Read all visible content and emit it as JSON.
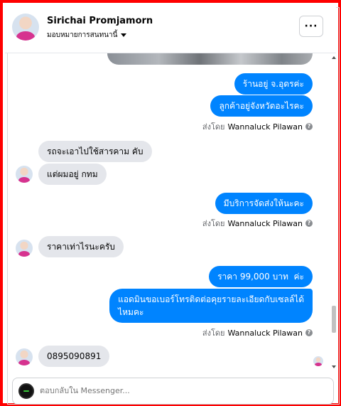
{
  "header": {
    "contact_name": "Sirichai Promjamorn",
    "subtitle": "มอบหมายการสนทนานี้",
    "more_label": "···"
  },
  "messages": [
    {
      "direction": "outgoing",
      "text": "ร้านอยู่ จ.อุดรค่ะ"
    },
    {
      "direction": "outgoing",
      "text": "ลูกค้าอยู่จังหวัดอะไรคะ"
    },
    {
      "direction": "incoming",
      "text": "รถจะเอาไปใช้สารคาม คับ"
    },
    {
      "direction": "incoming",
      "text": "แต่ผมอยู่ กทม"
    },
    {
      "direction": "outgoing",
      "text": "มีบริการจัดส่งให้นะคะ"
    },
    {
      "direction": "incoming",
      "text": "ราคาเท่าไรนะครับ"
    },
    {
      "direction": "outgoing",
      "text": "ราคา 99,000 บาท  ค่ะ"
    },
    {
      "direction": "outgoing",
      "text_line1": "แอดมินขอเบอร์โทรติดต่อคุยรายละเอียดกับเซลล์ได้",
      "text_line2": "ไหมคะ"
    },
    {
      "direction": "incoming",
      "text": "0895090891"
    }
  ],
  "sent_by": {
    "prefix": "ส่งโดย",
    "sender": "Wannaluck Pilawan",
    "help_icon": "?"
  },
  "composer": {
    "placeholder": "ตอบกลับใน Messenger..."
  },
  "colors": {
    "outgoing_bubble": "#0084ff",
    "incoming_bubble": "#e4e6eb",
    "frame_border": "#ff0000"
  }
}
